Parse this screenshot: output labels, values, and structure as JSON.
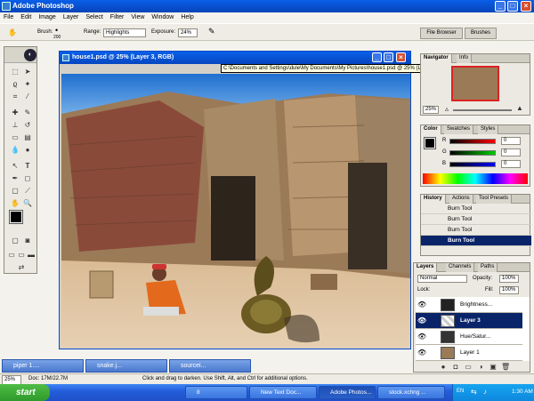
{
  "app": {
    "title": "Adobe Photoshop"
  },
  "menu": [
    "File",
    "Edit",
    "Image",
    "Layer",
    "Select",
    "Filter",
    "View",
    "Window",
    "Help"
  ],
  "options": {
    "brush_label": "Brush:",
    "brush_size": "200",
    "range_label": "Range:",
    "range_value": "Highlights",
    "exposure_label": "Exposure:",
    "exposure_value": "24%",
    "file_browser": "File Browser",
    "brushes": "Brushes"
  },
  "document": {
    "title": "house1.psd @ 25% (Layer 3, RGB)",
    "path_tooltip": "C:\\Documents and Settings\\dule\\My Documents\\My Pictures\\house1.psd @ 25% (Layer 3, RGB)"
  },
  "status": {
    "zoom": "25%",
    "doc": "Doc: 17M/22.7M",
    "hint": "Click and drag to darken. Use Shift, Alt, and Ctrl for additional options."
  },
  "minimized_docs": [
    "piper 1....",
    "snake.j...",
    "sourcei..."
  ],
  "navigator": {
    "tabs": [
      "Navigator",
      "Info"
    ],
    "zoom": "25%"
  },
  "color": {
    "tabs": [
      "Color",
      "Swatches",
      "Styles"
    ],
    "channels": [
      {
        "label": "R",
        "value": "0"
      },
      {
        "label": "G",
        "value": "0"
      },
      {
        "label": "B",
        "value": "0"
      }
    ]
  },
  "history": {
    "tabs": [
      "History",
      "Actions",
      "Tool Presets"
    ],
    "items": [
      "Burn Tool",
      "Burn Tool",
      "Burn Tool",
      "Burn Tool"
    ]
  },
  "layers": {
    "tabs": [
      "Layers",
      "Channels",
      "Paths"
    ],
    "blend": "Normal",
    "opacity_label": "Opacity:",
    "opacity": "100%",
    "lock_label": "Lock:",
    "fill_label": "Fill:",
    "fill": "100%",
    "items": [
      "Brightness...",
      "Layer 3",
      "Hue/Satur...",
      "Layer 1"
    ]
  },
  "taskbar": {
    "start": "start",
    "buttons": [
      "8",
      "New Text Doc...",
      "Adobe Photos...",
      "stock.xchng ..."
    ],
    "lang": "EN",
    "clock": "1:30 AM"
  },
  "colors": {
    "xp_blue": "#245edb",
    "start_green": "#2f9a2b",
    "selection": "#0a246a"
  }
}
